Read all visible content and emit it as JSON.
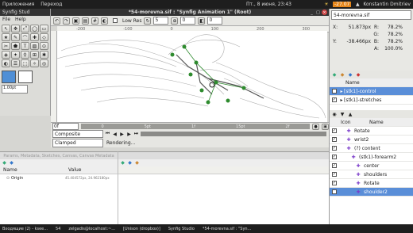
{
  "top_panel": {
    "apps_menu": "Приложения",
    "places_menu": "Переход",
    "clock": "Пт., 8 июня, 23:43",
    "temperature": "-27.07",
    "user": "Konstantin Dmitriev"
  },
  "toolbox_window": {
    "title": "Synfig Stud",
    "menu": [
      "File",
      "Help"
    ],
    "spin_value": "1.00pt"
  },
  "canvas_window": {
    "title": "*54-morevna.sif : \"Synfig Animation 1\" (Root)",
    "low_res_label": "Low Res",
    "spin1": "5",
    "spin2": "0",
    "spin3": "0",
    "ruler_marks": [
      "-200",
      "-100",
      "0",
      "100",
      "200",
      "300"
    ],
    "timebar_marks": [
      "0",
      "5pt",
      "1f",
      "15pt",
      "2f"
    ],
    "frame_field": "0f",
    "composite_label": "Composite",
    "clamped_label": "Clamped",
    "status": "Rendering..."
  },
  "info_panel": {
    "title": "54-morevna.sif",
    "x_label": "X:",
    "x_value": "51.873px",
    "y_label": "Y:",
    "y_value": "-38.466px",
    "r_label": "R:",
    "r_value": "78.2%",
    "g_label": "G:",
    "g_value": "78.2%",
    "b_label": "B:",
    "b_value": "78.2%",
    "a_label": "A:",
    "a_value": "100.0%"
  },
  "layers_top": {
    "col_name": "Name",
    "rows": [
      "[stk1]-control",
      "[stk1]-stretches"
    ]
  },
  "params_panel": {
    "tabs_label": "Params, Metadata, Sketches, Canvas, Canvas Metadata",
    "col_name": "Name",
    "col_value": "Value",
    "row_name": "Origin",
    "row_value": "45.404572px, 24.962180px"
  },
  "layers_bottom": {
    "col_icon": "Icon",
    "col_name": "Name",
    "rows": [
      {
        "label": "Rotate",
        "indent": 0,
        "selected": false
      },
      {
        "label": "wrist2",
        "indent": 0,
        "selected": false
      },
      {
        "label": "(?) content",
        "indent": 0,
        "selected": false
      },
      {
        "label": "(stk1)-forearm2",
        "indent": 1,
        "selected": false
      },
      {
        "label": "center",
        "indent": 2,
        "selected": false
      },
      {
        "label": "shoulders",
        "indent": 2,
        "selected": false
      },
      {
        "label": "Rotate",
        "indent": 2,
        "selected": false
      },
      {
        "label": "shoulder2",
        "indent": 2,
        "selected": true
      }
    ]
  },
  "taskbar": {
    "items": [
      "Входящие (2) - ksee...",
      "54",
      "zelgadis@localhost:~...",
      "[Unison (dropbox)]",
      "Synfig Studio",
      "*54-morevna.sif : \"Syn..."
    ]
  },
  "colors": {
    "panel_bg": "#1e1e1e",
    "selection": "#5a8ed8",
    "canvas_bg": "#ffffff",
    "duck_green": "#2e8b2e"
  }
}
